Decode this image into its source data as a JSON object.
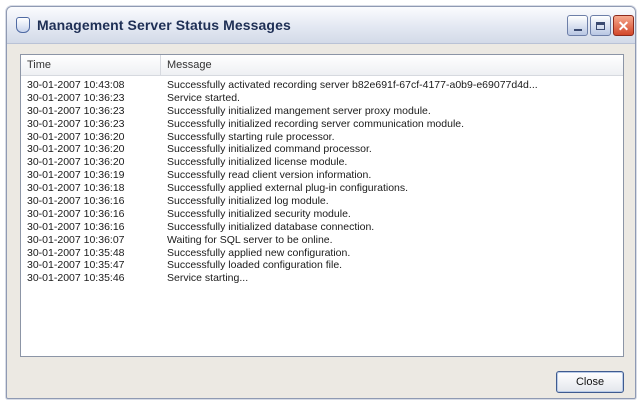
{
  "window": {
    "title": "Management Server Status Messages"
  },
  "columns": {
    "time": "Time",
    "message": "Message"
  },
  "rows": [
    {
      "time": "30-01-2007 10:43:08",
      "message": "Successfully activated recording server b82e691f-67cf-4177-a0b9-e69077d4d..."
    },
    {
      "time": "30-01-2007 10:36:23",
      "message": "Service started."
    },
    {
      "time": "30-01-2007 10:36:23",
      "message": "Successfully initialized mangement server proxy module."
    },
    {
      "time": "30-01-2007 10:36:23",
      "message": "Successfully initialized recording server communication module."
    },
    {
      "time": "30-01-2007 10:36:20",
      "message": "Successfully starting rule processor."
    },
    {
      "time": "30-01-2007 10:36:20",
      "message": "Successfully initialized command processor."
    },
    {
      "time": "30-01-2007 10:36:20",
      "message": "Successfully initialized license module."
    },
    {
      "time": "30-01-2007 10:36:19",
      "message": "Successfully read client version information."
    },
    {
      "time": "30-01-2007 10:36:18",
      "message": "Successfully applied external plug-in configurations."
    },
    {
      "time": "30-01-2007 10:36:16",
      "message": "Successfully initialized log module."
    },
    {
      "time": "30-01-2007 10:36:16",
      "message": "Successfully initialized security module."
    },
    {
      "time": "30-01-2007 10:36:16",
      "message": "Successfully initialized database connection."
    },
    {
      "time": "30-01-2007 10:36:07",
      "message": "Waiting for SQL server to be online."
    },
    {
      "time": "30-01-2007 10:35:48",
      "message": "Successfully applied new configuration."
    },
    {
      "time": "30-01-2007 10:35:47",
      "message": "Successfully loaded configuration file."
    },
    {
      "time": "30-01-2007 10:35:46",
      "message": "Service starting..."
    }
  ],
  "buttons": {
    "close": "Close"
  },
  "icons": {
    "app": "shield-icon",
    "minimize": "minimize-icon",
    "maximize": "maximize-icon",
    "close": "close-icon"
  },
  "colors": {
    "title_text": "#1e2f55",
    "close_control": "#d2472a"
  }
}
